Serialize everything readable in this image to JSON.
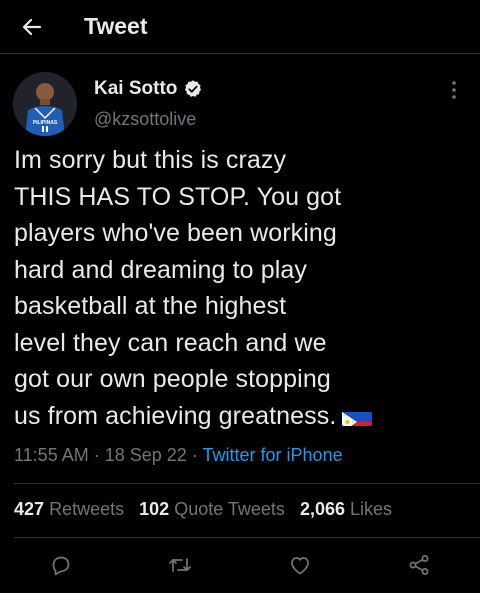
{
  "header": {
    "title": "Tweet"
  },
  "author": {
    "name": "Kai Sotto",
    "handle": "@kzsottolive",
    "jersey_text": "PILIPINAS"
  },
  "tweet": {
    "text": "Im sorry but this is crazy\nTHIS HAS TO STOP. You got\nplayers who've been working\nhard and dreaming to play\nbasketball at the highest\nlevel they can reach and we\ngot our own people stopping\nus from achieving greatness.",
    "time": "11:55 AM",
    "date": "18 Sep 22",
    "source": "Twitter for iPhone",
    "separator": "·"
  },
  "stats": {
    "retweets_count": "427",
    "retweets_label": "Retweets",
    "quotes_count": "102",
    "quotes_label": "Quote Tweets",
    "likes_count": "2,066",
    "likes_label": "Likes"
  },
  "colors": {
    "background": "#000000",
    "text": "#e7e9ea",
    "secondary": "#71767b",
    "accent": "#1d9bf0",
    "divider": "#2f3336"
  },
  "icons": {
    "back": "arrow-left-icon",
    "verified": "verified-badge-icon",
    "more": "more-icon",
    "reply": "reply-icon",
    "retweet": "retweet-icon",
    "like": "heart-icon",
    "share": "share-icon"
  }
}
